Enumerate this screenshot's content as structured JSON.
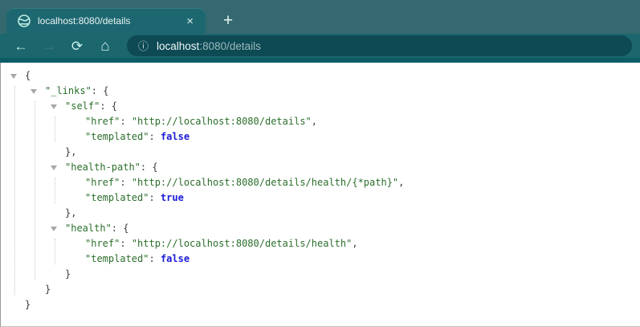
{
  "browser": {
    "tab": {
      "title": "localhost:8080/details",
      "close_icon": "×",
      "favicon": "globe-icon"
    },
    "new_tab_icon": "+",
    "toolbar": {
      "icons": {
        "back": "←",
        "forward": "→",
        "reload": "⟳",
        "home": "⌂",
        "info": "ⓘ"
      },
      "url": {
        "host": "localhost",
        "rest": ":8080/details"
      }
    },
    "colors": {
      "frame": "#35686F",
      "toolbar": "#1C666E",
      "active_tab": "#1D6770",
      "omnibox": "#0D4A54",
      "bottom_strip": "#0C5C68",
      "json_key": "#2B6E2B",
      "json_string": "#2B6E2B",
      "json_keyword": "#1B1AD6",
      "json_punct": "#3C3C3C"
    }
  },
  "json_viewer": {
    "base_indent": 30,
    "indent_step": 25,
    "line_height": 19,
    "pad_top": 7,
    "lines": [
      {
        "indent": 0,
        "expander": true,
        "tokens": [
          {
            "t": "punct",
            "v": "{"
          }
        ]
      },
      {
        "indent": 1,
        "expander": true,
        "tokens": [
          {
            "t": "key",
            "v": "\"_links\""
          },
          {
            "t": "punct",
            "v": ": {"
          }
        ]
      },
      {
        "indent": 2,
        "expander": true,
        "tokens": [
          {
            "t": "key",
            "v": "\"self\""
          },
          {
            "t": "punct",
            "v": ": {"
          }
        ]
      },
      {
        "indent": 3,
        "expander": false,
        "tokens": [
          {
            "t": "key",
            "v": "\"href\""
          },
          {
            "t": "punct",
            "v": ": "
          },
          {
            "t": "str",
            "v": "\"http://localhost:8080/details\""
          },
          {
            "t": "punct",
            "v": ","
          }
        ]
      },
      {
        "indent": 3,
        "expander": false,
        "tokens": [
          {
            "t": "key",
            "v": "\"templated\""
          },
          {
            "t": "punct",
            "v": ": "
          },
          {
            "t": "kw",
            "v": "false"
          }
        ]
      },
      {
        "indent": 2,
        "expander": false,
        "tokens": [
          {
            "t": "punct",
            "v": "},"
          }
        ]
      },
      {
        "indent": 2,
        "expander": true,
        "tokens": [
          {
            "t": "key",
            "v": "\"health-path\""
          },
          {
            "t": "punct",
            "v": ": {"
          }
        ]
      },
      {
        "indent": 3,
        "expander": false,
        "tokens": [
          {
            "t": "key",
            "v": "\"href\""
          },
          {
            "t": "punct",
            "v": ": "
          },
          {
            "t": "str",
            "v": "\"http://localhost:8080/details/health/{*path}\""
          },
          {
            "t": "punct",
            "v": ","
          }
        ]
      },
      {
        "indent": 3,
        "expander": false,
        "tokens": [
          {
            "t": "key",
            "v": "\"templated\""
          },
          {
            "t": "punct",
            "v": ": "
          },
          {
            "t": "kw",
            "v": "true"
          }
        ]
      },
      {
        "indent": 2,
        "expander": false,
        "tokens": [
          {
            "t": "punct",
            "v": "},"
          }
        ]
      },
      {
        "indent": 2,
        "expander": true,
        "tokens": [
          {
            "t": "key",
            "v": "\"health\""
          },
          {
            "t": "punct",
            "v": ": {"
          }
        ]
      },
      {
        "indent": 3,
        "expander": false,
        "tokens": [
          {
            "t": "key",
            "v": "\"href\""
          },
          {
            "t": "punct",
            "v": ": "
          },
          {
            "t": "str",
            "v": "\"http://localhost:8080/details/health\""
          },
          {
            "t": "punct",
            "v": ","
          }
        ]
      },
      {
        "indent": 3,
        "expander": false,
        "tokens": [
          {
            "t": "key",
            "v": "\"templated\""
          },
          {
            "t": "punct",
            "v": ": "
          },
          {
            "t": "kw",
            "v": "false"
          }
        ]
      },
      {
        "indent": 2,
        "expander": false,
        "tokens": [
          {
            "t": "punct",
            "v": "}"
          }
        ]
      },
      {
        "indent": 1,
        "expander": false,
        "tokens": [
          {
            "t": "punct",
            "v": "}"
          }
        ]
      },
      {
        "indent": 0,
        "expander": false,
        "tokens": [
          {
            "t": "punct",
            "v": "}"
          }
        ]
      }
    ],
    "guides": [
      {
        "level": 0,
        "from": 1,
        "to": 15
      },
      {
        "level": 1,
        "from": 2,
        "to": 14
      },
      {
        "level": 2,
        "from": 3,
        "to": 5
      },
      {
        "level": 2,
        "from": 7,
        "to": 9
      },
      {
        "level": 2,
        "from": 11,
        "to": 13
      }
    ]
  }
}
